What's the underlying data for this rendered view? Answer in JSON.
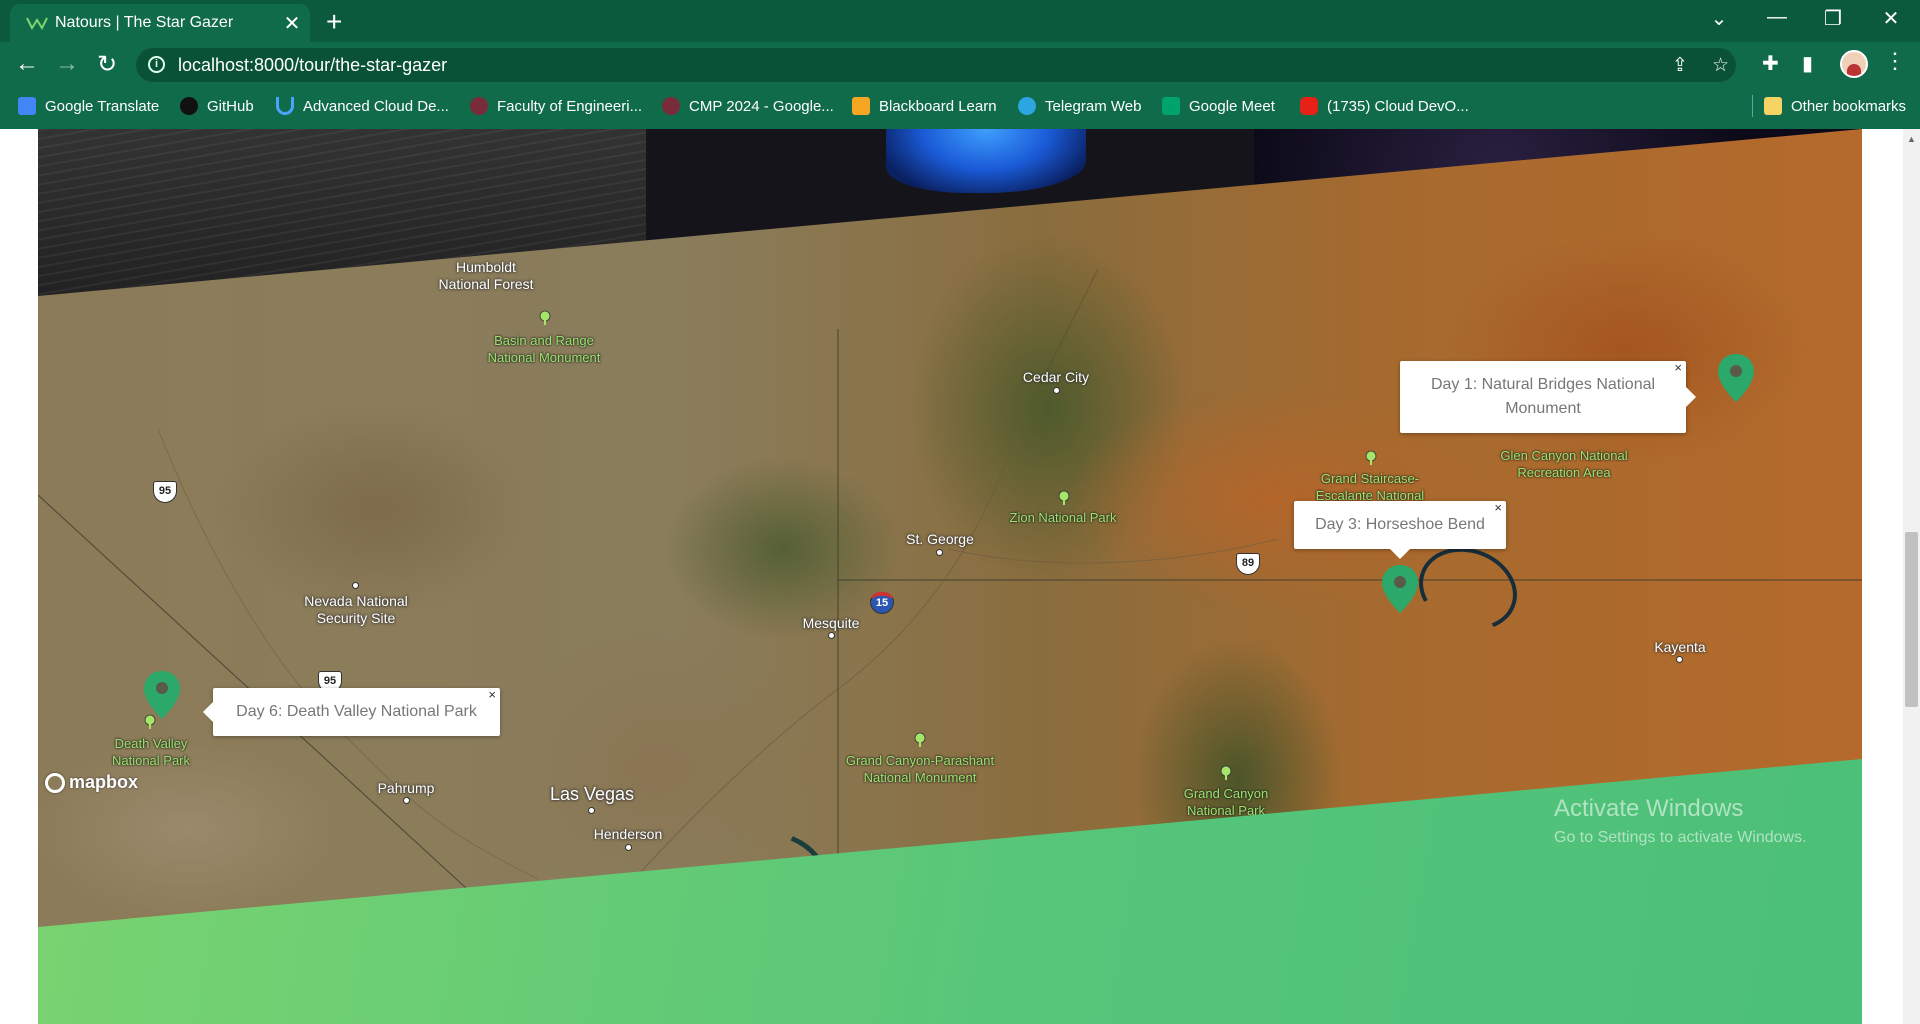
{
  "browser": {
    "tab_title": "Natours | The Star Gazer",
    "url": "localhost:8000/tour/the-star-gazer",
    "bookmarks": [
      {
        "label": "Google Translate",
        "icon": "google-translate-icon"
      },
      {
        "label": "GitHub",
        "icon": "github-icon"
      },
      {
        "label": "Advanced Cloud De...",
        "icon": "udemy-icon"
      },
      {
        "label": "Faculty of Engineeri...",
        "icon": "globe-icon"
      },
      {
        "label": "CMP 2024 - Google...",
        "icon": "globe-icon"
      },
      {
        "label": "Blackboard Learn",
        "icon": "blackboard-icon"
      },
      {
        "label": "Telegram Web",
        "icon": "telegram-icon"
      },
      {
        "label": "Google Meet",
        "icon": "google-meet-icon"
      },
      {
        "label": "(1735) Cloud DevO...",
        "icon": "youtube-icon"
      }
    ],
    "other_bookmarks": "Other bookmarks"
  },
  "map": {
    "attribution": "mapbox",
    "places": {
      "humboldt": "Humboldt\nNational Forest",
      "basin": "Basin and Range\nNational Monument",
      "cedar": "Cedar City",
      "zion": "Zion National Park",
      "stgeorge": "St. George",
      "grand_staircase": "Grand Staircase-\nEscalante National",
      "glen_canyon": "Glen Canyon National\nRecreation Area",
      "nevada_site": "Nevada National\nSecurity Site",
      "mesquite": "Mesquite",
      "kayenta": "Kayenta",
      "death_valley": "Death Valley\nNational Park",
      "pahrump": "Pahrump",
      "las_vegas": "Las Vegas",
      "henderson": "Henderson",
      "parashant": "Grand Canyon-Parashant\nNational Monument",
      "grand_canyon": "Grand Canyon\nNational Park"
    },
    "shields": {
      "us95a": "95",
      "us95b": "95",
      "i15": "15",
      "us89": "89"
    },
    "popups": {
      "day1": "Day 1: Natural Bridges National Monument",
      "day3": "Day 3: Horseshoe Bend",
      "day6": "Day 6: Death Valley National Park",
      "close": "×"
    }
  },
  "os_watermark": {
    "line1": "Activate Windows",
    "line2": "Go to Settings to activate Windows."
  },
  "colors": {
    "brand_green": "#55c57a",
    "marker_green": "#2ba86a",
    "chrome_green": "#0f6b4a"
  }
}
